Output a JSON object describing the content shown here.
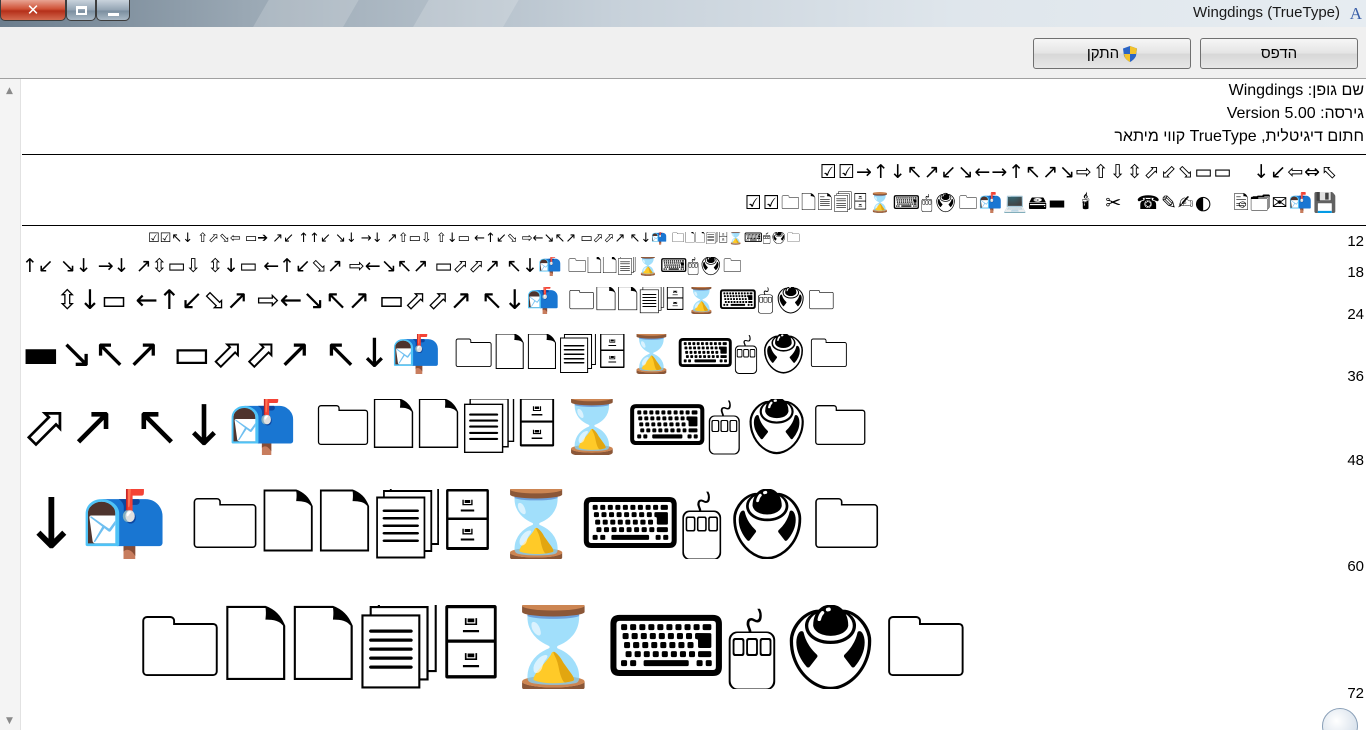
{
  "window": {
    "title": "Wingdings (TrueType)",
    "close_glyph": "✕",
    "app_icon_glyph": "A"
  },
  "toolbar": {
    "print_label": "הדפס",
    "install_label": "התקן"
  },
  "font_info": {
    "name_line": "שם גופן: Wingdings",
    "version_line": "גירסה: Version 5.00",
    "type_line": "חתום דיגיטלית, TrueType קווי מיתאר"
  },
  "character_set": {
    "line1": "☑☑→↑↓↖↗↙↘←→↑↖↗↘⇨⇧⇩⇳⬀⬃⬂▭▭   ↓↙⇦⇔⬁",
    "line2": "☑☑🗀🗋🗎🗐🗄⌛⌨🖱🖲🗀📬💻🖴▬  🕯  ✂  ☎✎✍◐   🗟🗂✉📬💾"
  },
  "sample_sizes": [
    {
      "size": "12",
      "glyphs": "☑☑↖↓  ⇧⬀⬂⇦  ▭➔  ↗↙  ↑↑↙  ↘↓  →↓  ↗⇧▭⇩  ⇧↓▭  ←↑↙⬂  ⇨←↘↖↗  ▭⬀⬀↗  ↖↓📬  🗀🗋🗋🗐🗄⌛⌨🖱🖲🗀"
    },
    {
      "size": "18",
      "glyphs": "↑↙  ↘↓  →↓  ↗⇳▭⇩  ⇳↓▭  ←↑↙⬂↗  ⇨←↘↖↗  ▭⬀⬀↗  ↖↓📬  🗀🗋🗋🗐⌛⌨🖱🖲🗀"
    },
    {
      "size": "24",
      "glyphs": "⇳↓▭  ←↑↙⬂↗  ⇨←↘↖↗  ▭⬀⬀↗  ↖↓📬  🗀🗋🗋🗐🗄⌛⌨🖱🖲🗀"
    },
    {
      "size": "36",
      "glyphs": "▬↘↖↗  ▭⬀⬀↗  ↖↓📬  🗀🗋🗋🗐🗄⌛⌨🖱🖲🗀"
    },
    {
      "size": "48",
      "glyphs": "⬀↗  ↖↓📬  🗀🗋🗋🗐🗄⌛⌨🖱🖲🗀"
    },
    {
      "size": "60",
      "glyphs": "↓📬  🗀🗋🗋🗐🗄⌛⌨🖱🖲🗀"
    },
    {
      "size": "72",
      "glyphs": "🗀🗋🗋🗐🗄⌛⌨🖱🖲🗀"
    }
  ]
}
